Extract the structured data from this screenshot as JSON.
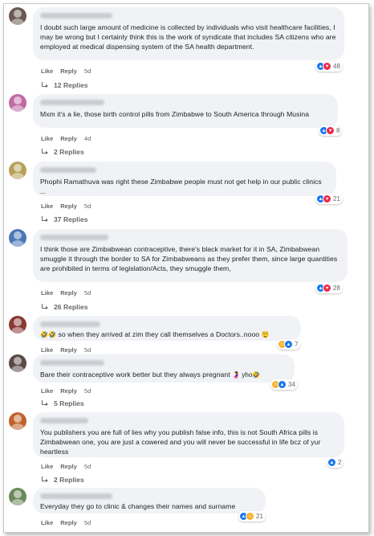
{
  "comments": [
    {
      "text": "I doubt such large amount of medicine is collected by individuals who visit healthcare facilities, I may be wrong but I certainly think this is the work of syndicate that includes SA citizens who are employed at medical dispensing system of the SA health department.",
      "like": "Like",
      "reply": "Reply",
      "time": "5d",
      "reaction_count": "48",
      "reactions": [
        "like",
        "love"
      ],
      "replies": "12 Replies",
      "avatar_color": "#6b5a52"
    },
    {
      "text": "Mxm it's a lie, those birth control pills from Zimbabwe to South America through Musina",
      "like": "Like",
      "reply": "Reply",
      "time": "4d",
      "reaction_count": "8",
      "reactions": [
        "like",
        "love"
      ],
      "replies": "2 Replies",
      "avatar_color": "#c06aa4"
    },
    {
      "text": "Phophi Ramathuva was right these Zimbabwe people must not get help in our public clinics ...",
      "like": "Like",
      "reply": "Reply",
      "time": "5d",
      "reaction_count": "21",
      "reactions": [
        "like",
        "love"
      ],
      "replies": "37 Replies",
      "avatar_color": "#b8a05a"
    },
    {
      "text": "I think those are Zimbabwean contraceptive, there's black market for it in SA, Zimbabwean smuggle it through the border to SA for Zimbabweans as they prefer them, since large quantities are prohibited in terms of legislation/Acts, they smuggle them,",
      "like": "Like",
      "reply": "Reply",
      "time": "5d",
      "reaction_count": "28",
      "reactions": [
        "like",
        "love"
      ],
      "replies": "26 Replies",
      "avatar_color": "#4a78b8"
    },
    {
      "emoji_prefix": "🤣🤣",
      "text": "so when they arrived at zim they call themselves a Doctors..nooo",
      "emoji_suffix": "😲",
      "like": "Like",
      "reply": "Reply",
      "time": "5d",
      "reaction_count": "7",
      "reactions": [
        "haha",
        "like"
      ],
      "replies": "",
      "avatar_color": "#8a3a36"
    },
    {
      "text": "Bare their contraceptive work better but they always pregnant",
      "emoji_suffix": "🤰 yho🤣",
      "like": "Like",
      "reply": "Reply",
      "time": "5d",
      "reaction_count": "34",
      "reactions": [
        "haha",
        "like"
      ],
      "replies": "5 Replies",
      "avatar_color": "#5a4a46"
    },
    {
      "text": "You publishers you are full of lies why you publish false info, this is not South Africa pills is Zimbabwean one, you are just a cowered and you will never be successful in life bcz of yur heartless",
      "like": "Like",
      "reply": "Reply",
      "time": "5d",
      "reaction_count": "2",
      "reactions": [
        "like"
      ],
      "replies": "2 Replies",
      "avatar_color": "#c0622e"
    },
    {
      "text": "Everyday they go to clinic & changes their names and surname",
      "like": "Like",
      "reply": "Reply",
      "time": "5d",
      "reaction_count": "21",
      "reactions": [
        "like",
        "haha"
      ],
      "replies": "",
      "avatar_color": "#6a8a5a"
    }
  ],
  "colors": {
    "bubble": "#f0f2f5",
    "secondary_text": "#65676b",
    "like_blue": "#1877f2",
    "love_red": "#f02849",
    "haha_yellow": "#f7b125"
  },
  "icons": {
    "like": "thumbs-up-icon",
    "love": "heart-icon",
    "haha": "laughing-face-icon",
    "reply_arrow": "reply-arrow-icon"
  }
}
